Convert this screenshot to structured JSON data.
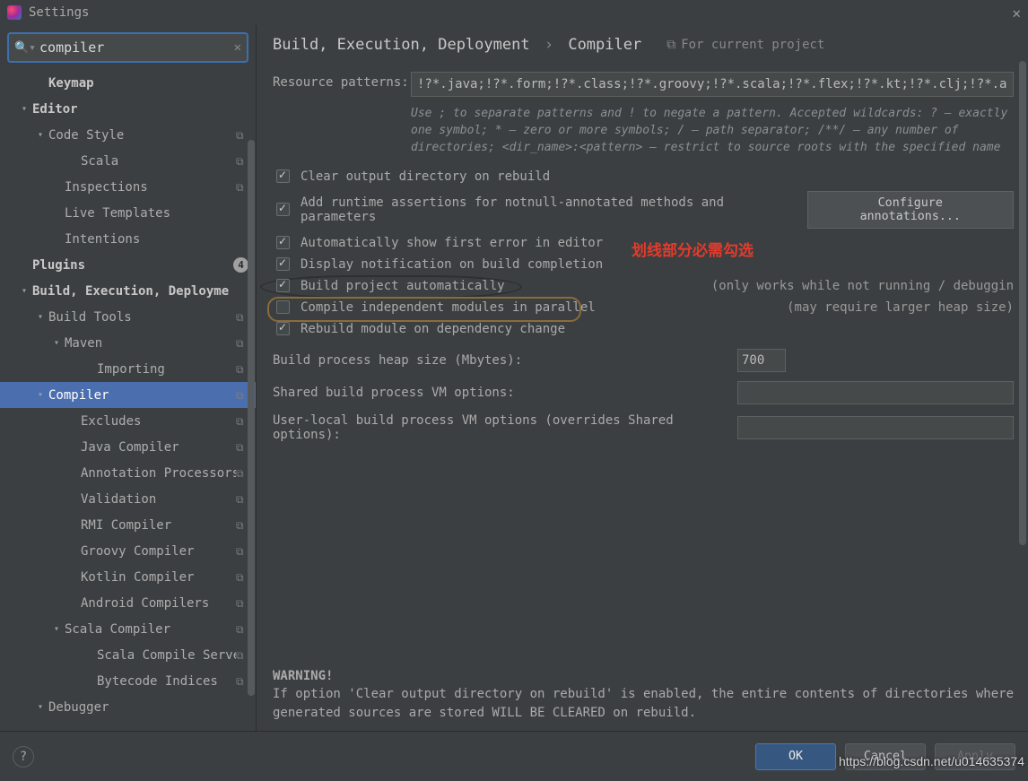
{
  "window": {
    "title": "Settings"
  },
  "search": {
    "value": "compiler"
  },
  "tree": [
    {
      "label": "Keymap",
      "indent": 2,
      "bold": true
    },
    {
      "label": "Editor",
      "indent": 1,
      "bold": true,
      "arrow": "down"
    },
    {
      "label": "Code Style",
      "indent": 2,
      "arrow": "down",
      "copy": true
    },
    {
      "label": "Scala",
      "indent": 4,
      "copy": true
    },
    {
      "label": "Inspections",
      "indent": 3,
      "copy": true
    },
    {
      "label": "Live Templates",
      "indent": 3
    },
    {
      "label": "Intentions",
      "indent": 3
    },
    {
      "label": "Plugins",
      "indent": 1,
      "bold": true,
      "badge": "4"
    },
    {
      "label": "Build, Execution, Deployme",
      "indent": 1,
      "bold": true,
      "arrow": "down"
    },
    {
      "label": "Build Tools",
      "indent": 2,
      "arrow": "down",
      "copy": true
    },
    {
      "label": "Maven",
      "indent": 3,
      "arrow": "down",
      "copy": true
    },
    {
      "label": "Importing",
      "indent": 5,
      "copy": true
    },
    {
      "label": "Compiler",
      "indent": 2,
      "arrow": "down",
      "copy": true,
      "selected": true
    },
    {
      "label": "Excludes",
      "indent": 4,
      "copy": true
    },
    {
      "label": "Java Compiler",
      "indent": 4,
      "copy": true
    },
    {
      "label": "Annotation Processors",
      "indent": 4,
      "copy": true
    },
    {
      "label": "Validation",
      "indent": 4,
      "copy": true
    },
    {
      "label": "RMI Compiler",
      "indent": 4,
      "copy": true
    },
    {
      "label": "Groovy Compiler",
      "indent": 4,
      "copy": true
    },
    {
      "label": "Kotlin Compiler",
      "indent": 4,
      "copy": true
    },
    {
      "label": "Android Compilers",
      "indent": 4,
      "copy": true
    },
    {
      "label": "Scala Compiler",
      "indent": 3,
      "arrow": "down",
      "copy": true
    },
    {
      "label": "Scala Compile Serve",
      "indent": 5,
      "copy": true
    },
    {
      "label": "Bytecode Indices",
      "indent": 5,
      "copy": true
    },
    {
      "label": "Debugger",
      "indent": 2,
      "arrow": "down"
    }
  ],
  "breadcrumb": {
    "a": "Build, Execution, Deployment",
    "b": "Compiler"
  },
  "scope": "For current project",
  "form": {
    "pattern_label": "Resource patterns:",
    "pattern_value": "!?*.java;!?*.form;!?*.class;!?*.groovy;!?*.scala;!?*.flex;!?*.kt;!?*.clj;!?*.aj",
    "pattern_hint": "Use ; to separate patterns and ! to negate a pattern. Accepted wildcards: ? — exactly one symbol; * — zero or more symbols; / — path separator; /**/ — any number of directories; <dir_name>:<pattern> — restrict to source roots with the specified name",
    "cb_clear": "Clear output directory on rebuild",
    "cb_assert": "Add runtime assertions for notnull-annotated methods and parameters",
    "btn_conf": "Configure annotations...",
    "cb_firsterr": "Automatically show first error in editor",
    "cb_notif": "Display notification on build completion",
    "cb_auto": "Build project automatically",
    "auto_side": "(only works while not running / debuggin",
    "cb_parallel": "Compile independent modules in parallel",
    "parallel_side": "(may require larger heap size)",
    "cb_rebuild": "Rebuild module on dependency change",
    "heap_label": "Build process heap size (Mbytes):",
    "heap_value": "700",
    "shared_label": "Shared build process VM options:",
    "user_label": "User-local build process VM options (overrides Shared options):"
  },
  "warning": {
    "title": "WARNING!",
    "body": "If option 'Clear output directory on rebuild' is enabled, the entire contents of directories where generated sources are stored WILL BE CLEARED on rebuild."
  },
  "footer": {
    "ok": "OK",
    "cancel": "Cancel",
    "apply": "Apply"
  },
  "annot": {
    "red": "划线部分必需勾选"
  },
  "watermark": "https://blog.csdn.net/u014635374"
}
